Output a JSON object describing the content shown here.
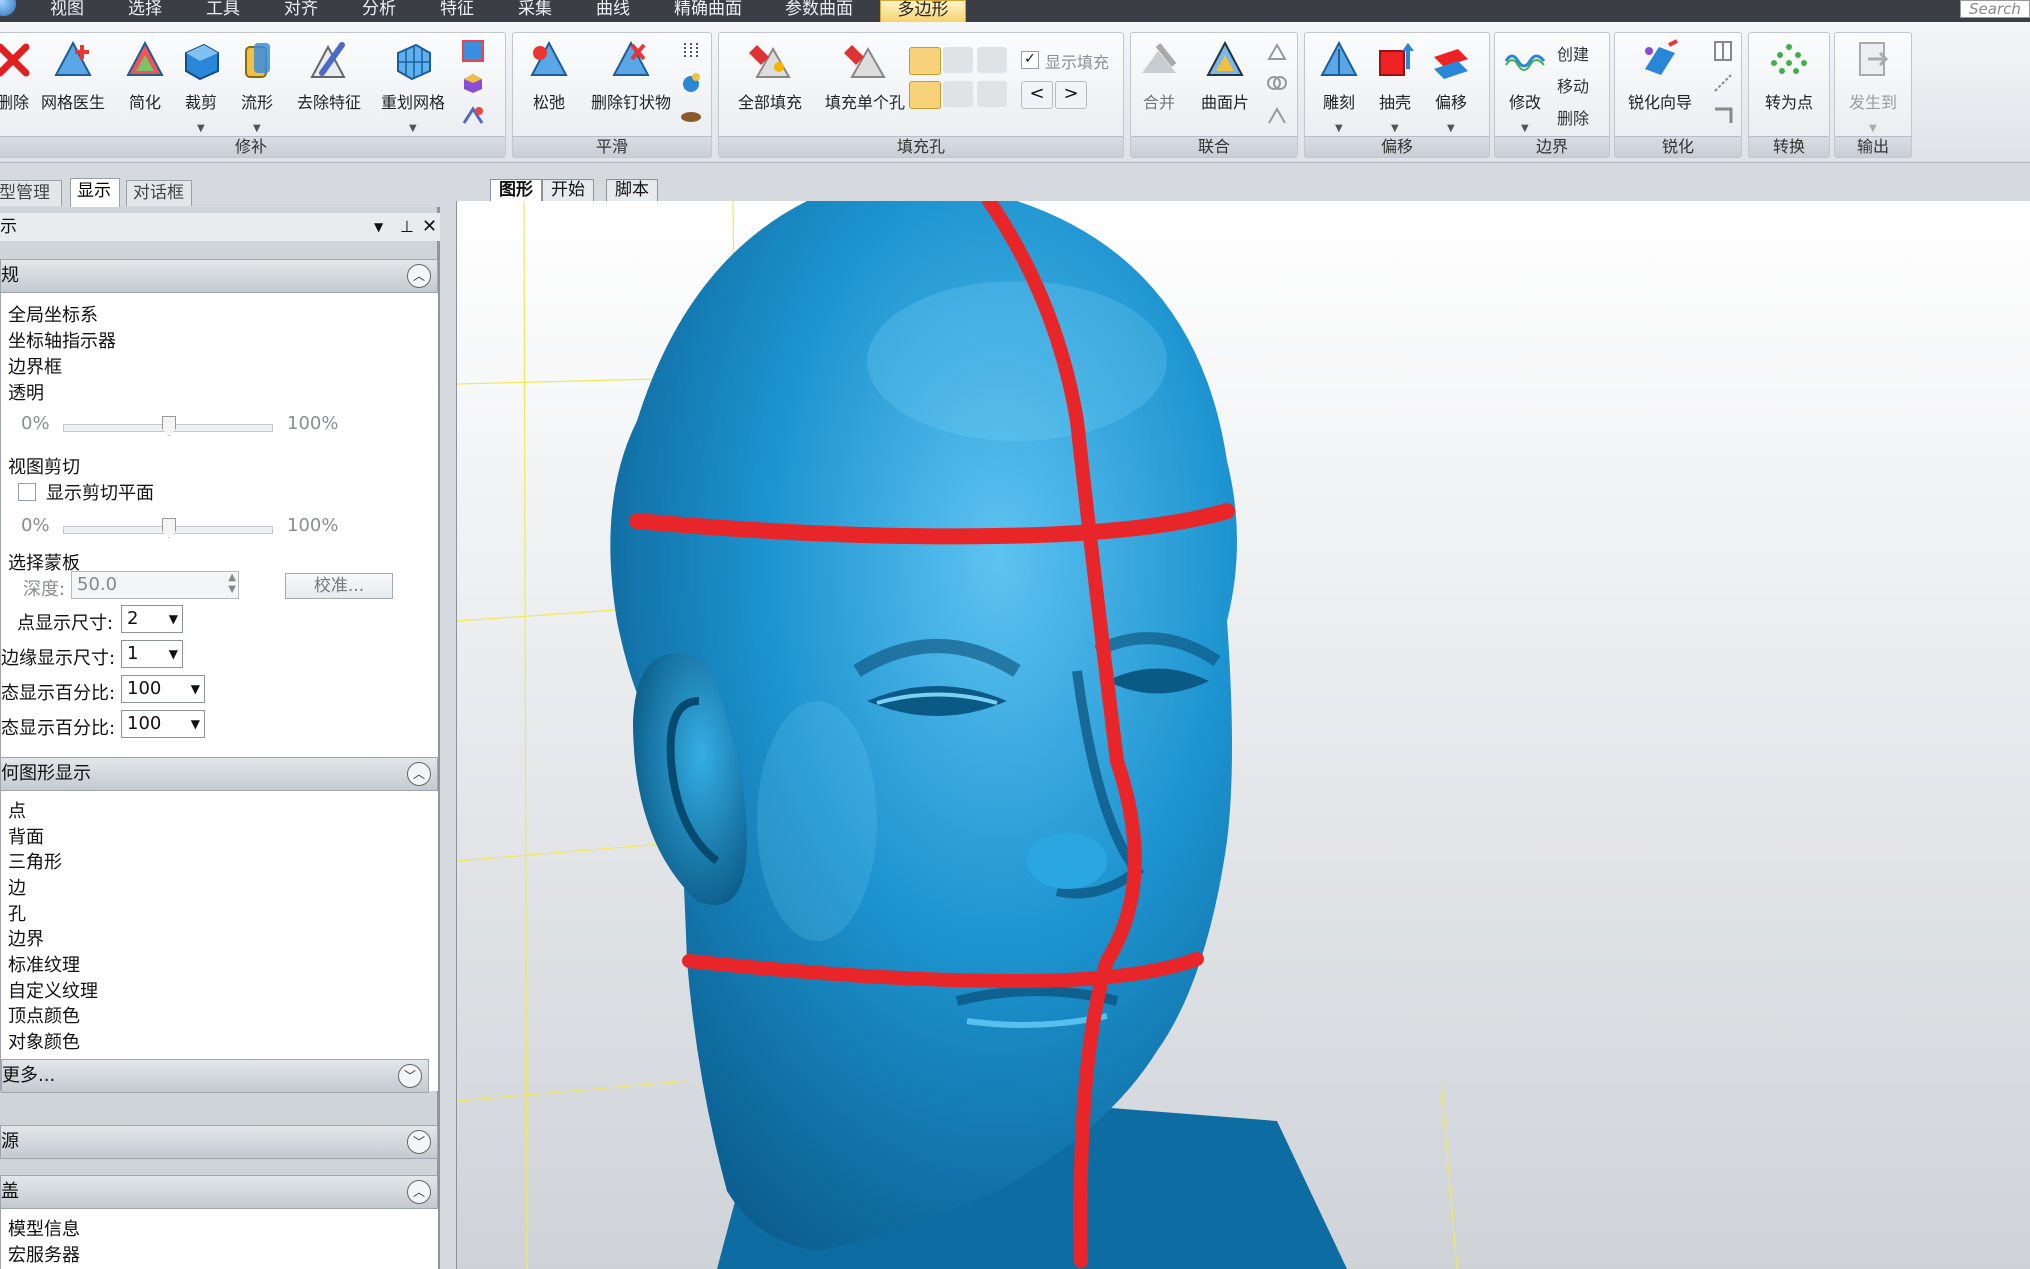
{
  "menu": {
    "items": [
      "视图",
      "选择",
      "工具",
      "对齐",
      "分析",
      "特征",
      "采集",
      "曲线",
      "精确曲面",
      "参数曲面",
      "多边形"
    ],
    "active": "多边形",
    "search_placeholder": "Search"
  },
  "ribbon": {
    "groups": {
      "repair": "修补",
      "smooth": "平滑",
      "fill_holes": "填充孔",
      "combine": "联合",
      "offset": "偏移",
      "boundary": "边界",
      "sharpen": "锐化",
      "convert": "转换",
      "output": "输出"
    },
    "tools": {
      "delete": "删除",
      "mesh_doctor": "网格医生",
      "simplify": "简化",
      "trim": "裁剪",
      "flow": "流形",
      "remove_feature": "去除特征",
      "remesh": "重划网格",
      "relax": "松弛",
      "remove_spikes": "删除钉状物",
      "fill_all": "全部填充",
      "fill_single": "填充单个孔",
      "show_fill": "显示填充",
      "merge": "合并",
      "patch": "曲面片",
      "emboss": "雕刻",
      "shell": "抽壳",
      "offset": "偏移",
      "modify": "修改",
      "create": "创建",
      "move": "移动",
      "delete_small": "删除",
      "sharpen_wizard": "锐化向导",
      "to_points": "转为点",
      "send_to": "发生到"
    }
  },
  "left_panel": {
    "tabs": [
      "型管理器",
      "显示",
      "对话框"
    ],
    "active_tab": "显示",
    "header": "示",
    "general": {
      "title": "规",
      "items": [
        "全局坐标系",
        "坐标轴指示器",
        "边界框",
        "透明"
      ],
      "transparency_min": "0%",
      "transparency_max": "100%",
      "transparency_value": 0.5,
      "view_clip": "视图剪切",
      "show_clip_plane": "显示剪切平面",
      "clip_min": "0%",
      "clip_max": "100%",
      "clip_value": 0.5,
      "selection_mask": "选择蒙板",
      "depth_label": "深度:",
      "depth_value": "50.0",
      "calibrate": "校准...",
      "point_size_label": "点显示尺寸:",
      "point_size": "2",
      "edge_size_label": "边缘显示尺寸:",
      "edge_size": "1",
      "static_pct_label": "态显示百分比:",
      "static_pct": "100",
      "dynamic_pct_label": "态显示百分比:",
      "dynamic_pct": "100"
    },
    "geometry_display": {
      "title": "何图形显示",
      "items": [
        "点",
        "背面",
        "三角形",
        "边",
        "孔",
        "边界",
        "标准纹理",
        "自定义纹理",
        "顶点颜色",
        "对象颜色"
      ],
      "more": "更多..."
    },
    "light_source": {
      "title": "源"
    },
    "overlay": {
      "title": "盖",
      "items": [
        "模型信息",
        "宏服务器"
      ]
    }
  },
  "viewport": {
    "tabs": [
      "图形",
      "开始",
      "脚本"
    ],
    "active_tab": "图形",
    "model_color": "#1a8fc9",
    "curve_color": "#e8262a"
  }
}
